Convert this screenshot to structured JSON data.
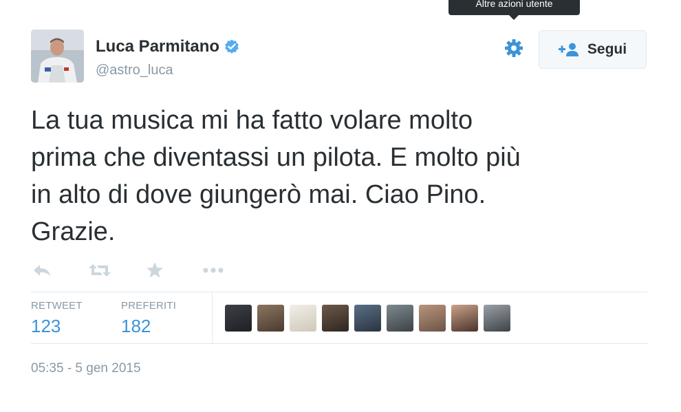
{
  "tooltip": {
    "text": "Altre azioni utente"
  },
  "user": {
    "name": "Luca Parmitano",
    "handle": "@astro_luca",
    "verified": true
  },
  "follow_button": {
    "label": "Segui",
    "icon": "add-user-icon"
  },
  "settings_icon": "gear-icon",
  "tweet": {
    "lines": [
      "La tua musica mi ha fatto volare molto",
      "prima che diventassi un pilota. E molto più",
      "in alto di dove giungerò mai. Ciao Pino.",
      "Grazie."
    ]
  },
  "actions": [
    "reply-icon",
    "retweet-icon",
    "favorite-star-icon",
    "more-dots-icon"
  ],
  "stats": {
    "retweet": {
      "label": "RETWEET",
      "value": "123"
    },
    "favorites": {
      "label": "PREFERITI",
      "value": "182"
    }
  },
  "favorited_by_avatars": 9,
  "timestamp": "05:35 - 5 gen 2015",
  "colors": {
    "text": "#292f33",
    "secondary": "#8899a6",
    "link": "#3b94d9",
    "accent": "#3b94d9",
    "verified": "#55acee"
  }
}
